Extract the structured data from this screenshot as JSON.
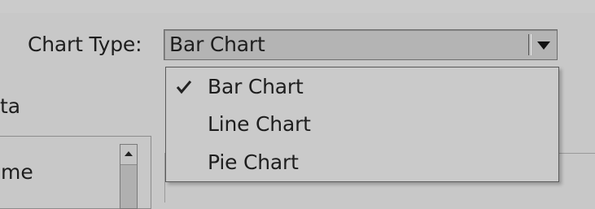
{
  "chart_type": {
    "label": "Chart Type:",
    "selected_value": "Bar Chart",
    "options": [
      {
        "label": "Bar Chart",
        "checked": true
      },
      {
        "label": "Line Chart",
        "checked": false
      },
      {
        "label": "Pie Chart",
        "checked": false
      }
    ]
  },
  "tabs": {
    "data_tab_visible_text": "ta"
  },
  "list_panel": {
    "header_visible_text": "me"
  },
  "icons": {
    "dropdown": "chevron-down-icon",
    "check": "check-icon",
    "scroll_up": "scroll-up-arrow-icon"
  },
  "colors": {
    "background": "#c8c8c8",
    "field_fill": "#b4b4b4",
    "menu_fill": "#cacaca",
    "text": "#1e1e1e"
  }
}
